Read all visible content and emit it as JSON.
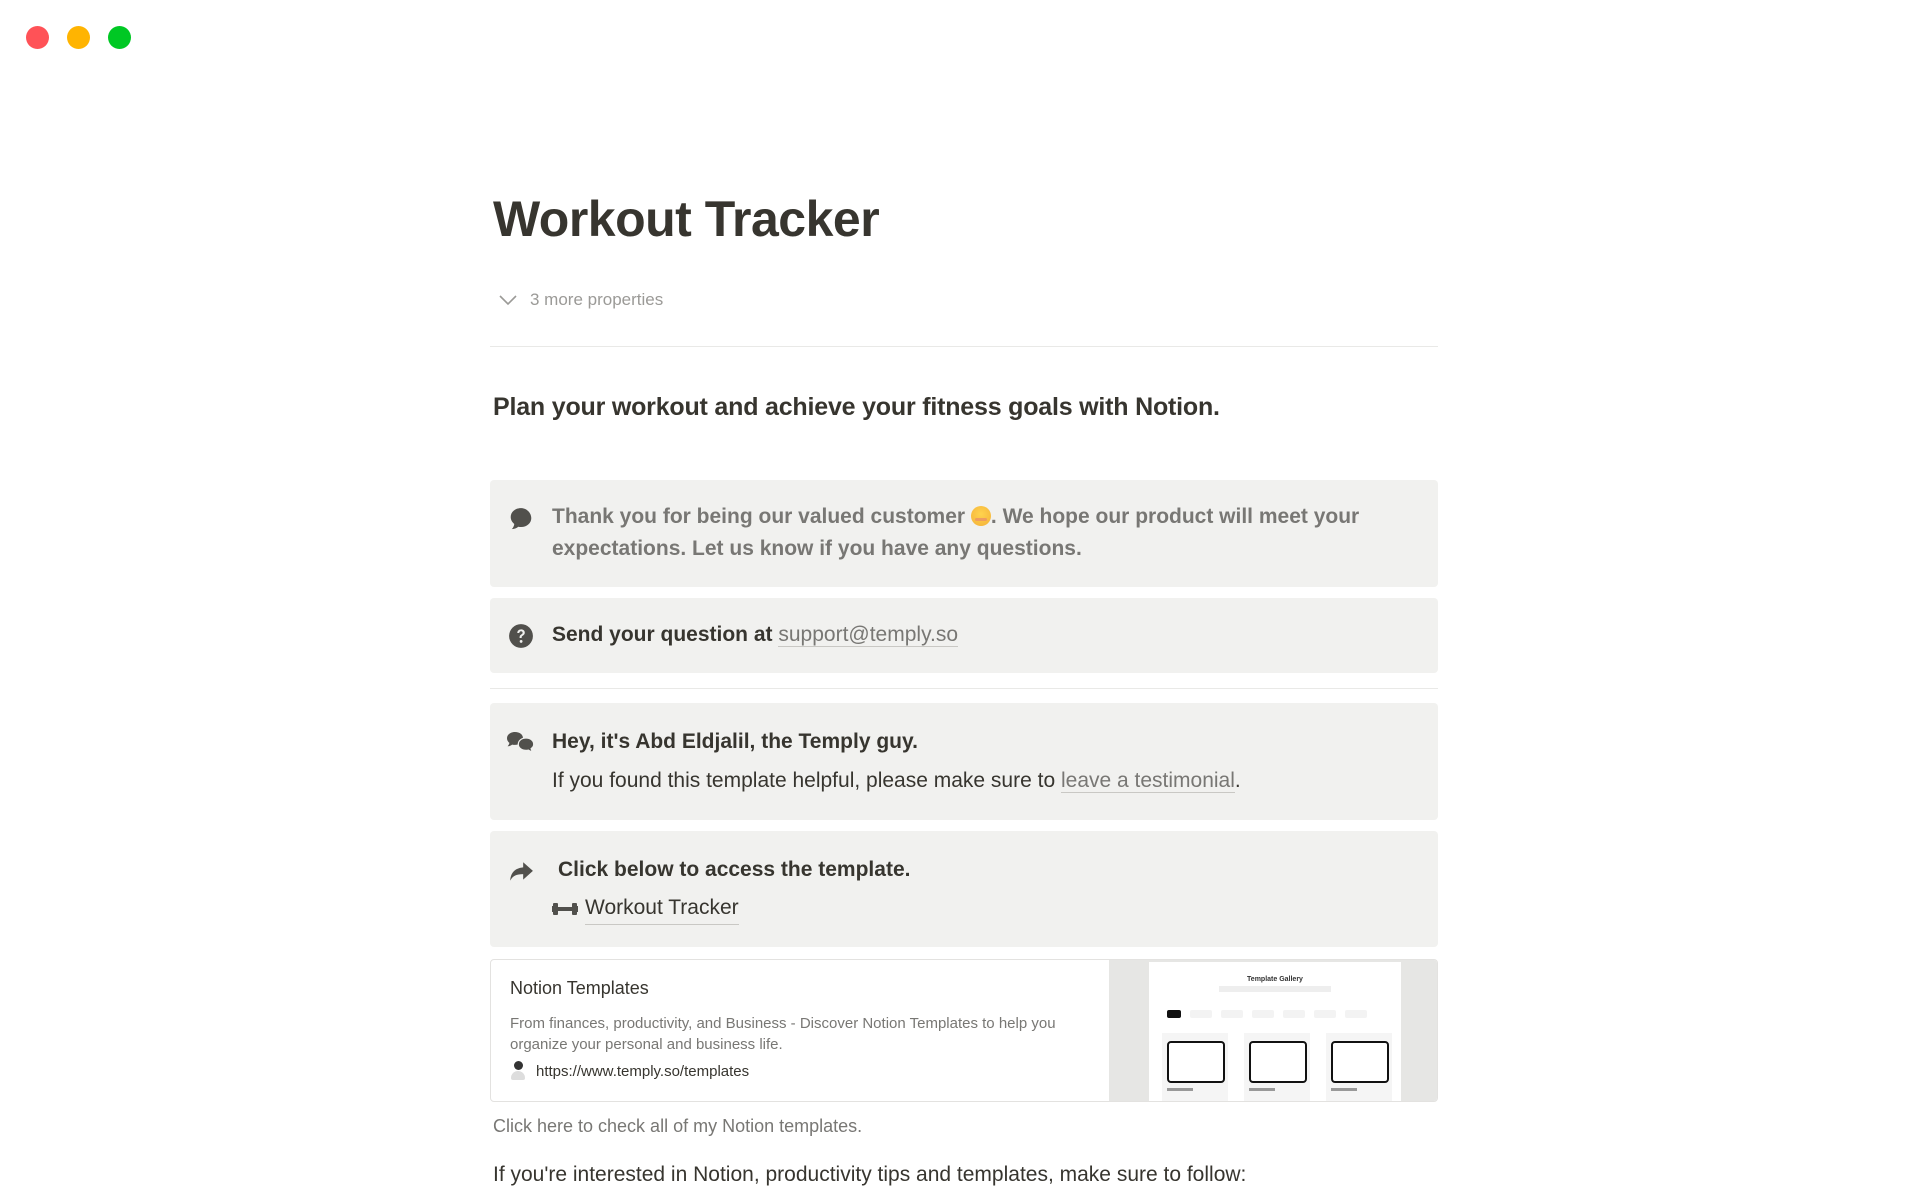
{
  "window": {
    "controls": [
      "close",
      "minimize",
      "maximize"
    ]
  },
  "page": {
    "title": "Workout Tracker",
    "properties_toggle": "3 more properties",
    "heading": "Plan your workout and achieve your fitness goals with Notion."
  },
  "callouts": [
    {
      "icon": "speech-bubble-icon",
      "text_before_emoji": "Thank you for being our valued customer ",
      "emoji": "relieved-face-emoji",
      "text_after_emoji": ". We hope our product will meet your expectations. Let us know if you have any questions."
    },
    {
      "icon": "question-circle-icon",
      "label": "Send your question at ",
      "link": "support@temply.so"
    },
    {
      "icon": "comments-icon",
      "title": "Hey, it's Abd Eldjalil, the Temply guy.",
      "body_before_link": "If you found this template helpful, please make sure to ",
      "link": "leave a testimonial",
      "body_after_link": "."
    },
    {
      "icon": "share-arrow-icon",
      "title": "Click below to access the template.",
      "page_link_icon": "dumbbell-icon",
      "page_link": "Workout Tracker"
    }
  ],
  "bookmark": {
    "title": "Notion Templates",
    "description": "From finances, productivity, and Business - Discover Notion Templates to help you organize your personal and business life.",
    "url": "https://www.temply.so/templates",
    "thumbnail": {
      "heading": "Template Gallery"
    }
  },
  "caption": "Click here to check all of my Notion templates.",
  "follow_paragraph": "If you're interested in Notion, productivity tips and templates, make sure to follow:",
  "colors": {
    "text": "#37352f",
    "muted": "#787774",
    "light_muted": "#9b9a97",
    "callout_bg": "#f1f1ef",
    "divider": "#e9e9e7"
  }
}
